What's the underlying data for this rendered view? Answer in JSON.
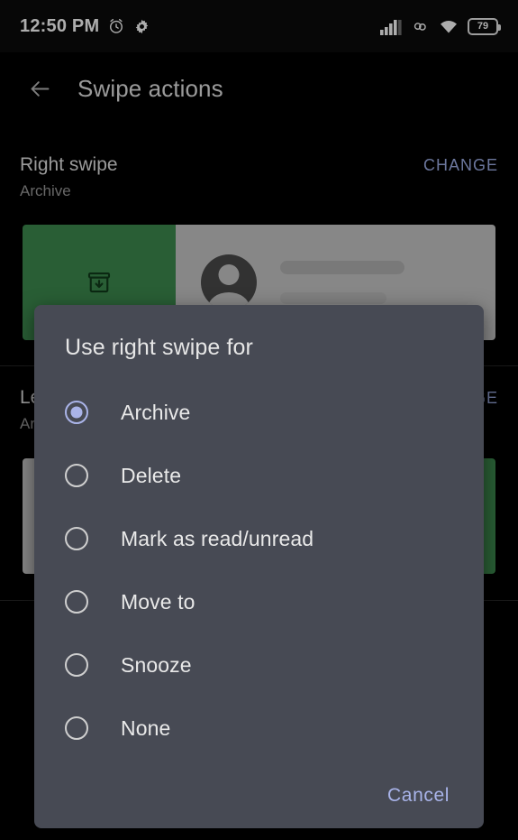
{
  "status_bar": {
    "time": "12:50 PM",
    "alarm_icon": "alarm-clock-icon",
    "settings_icon": "gear-icon",
    "signal_icon": "cellular-signal-icon",
    "vpn_icon": "data-saver-icon",
    "wifi_icon": "wifi-icon",
    "battery_level": "79"
  },
  "app_bar": {
    "back_icon": "back-arrow-icon",
    "title": "Swipe actions"
  },
  "sections": [
    {
      "title": "Right swipe",
      "subtitle": "Archive",
      "change_label": "CHANGE",
      "preview_icon": "archive-box-icon",
      "swipe_color": "#3d8b4f"
    },
    {
      "title": "Left swipe",
      "subtitle": "Archive",
      "change_label": "CHANGE",
      "preview_icon": "archive-box-icon",
      "swipe_color": "#3d8b4f"
    }
  ],
  "dialog": {
    "title": "Use right swipe for",
    "selected": "Archive",
    "options": [
      {
        "label": "Archive",
        "checked": true
      },
      {
        "label": "Delete",
        "checked": false
      },
      {
        "label": "Mark as read/unread",
        "checked": false
      },
      {
        "label": "Move to",
        "checked": false
      },
      {
        "label": "Snooze",
        "checked": false
      },
      {
        "label": "None",
        "checked": false
      }
    ],
    "cancel_label": "Cancel",
    "accent_color": "#aab4e8",
    "background_color": "#474a54"
  }
}
